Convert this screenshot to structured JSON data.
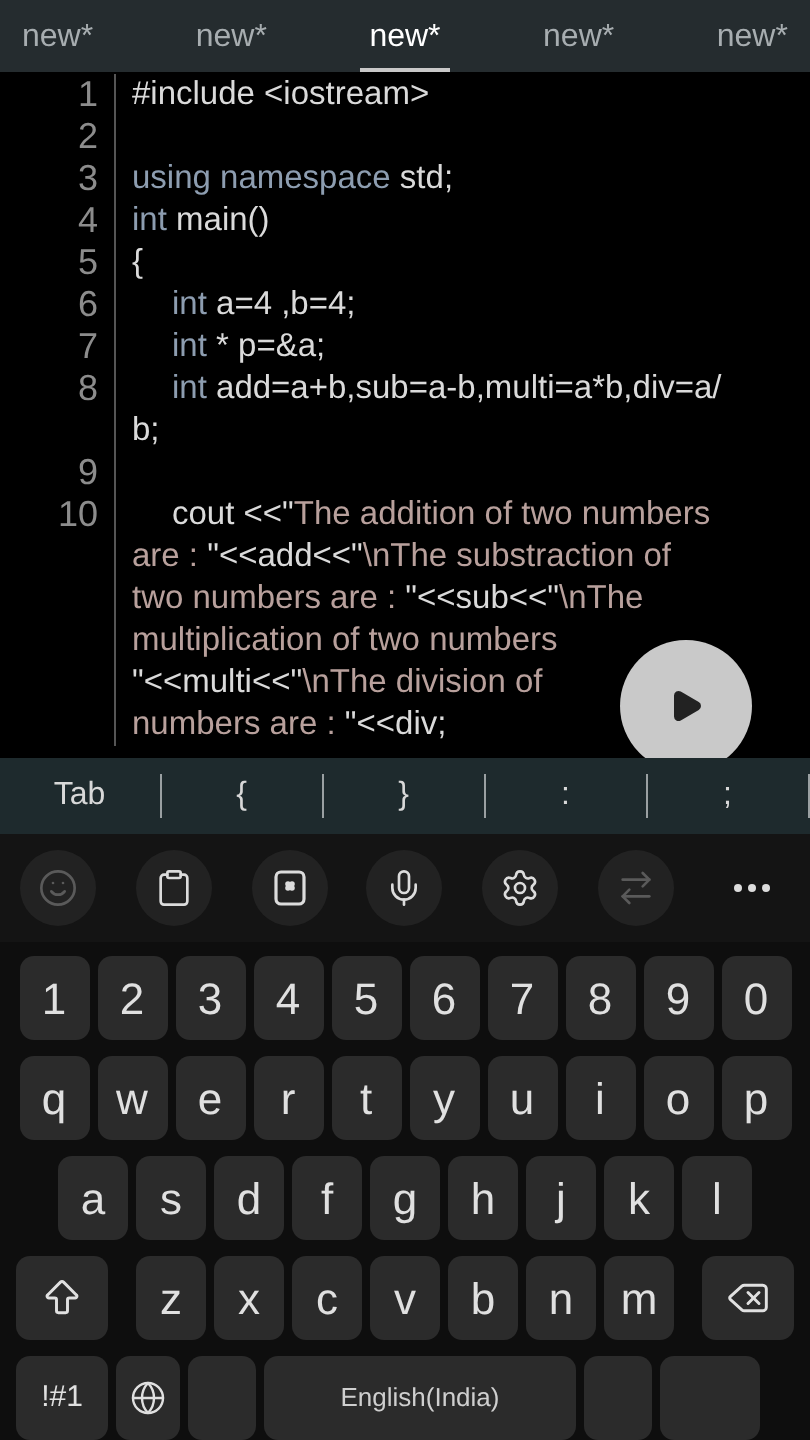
{
  "tabs": [
    {
      "label": "new*",
      "selected": false
    },
    {
      "label": "new*",
      "selected": false
    },
    {
      "label": "new*",
      "selected": true
    },
    {
      "label": "new*",
      "selected": false
    },
    {
      "label": "new*",
      "selected": false
    }
  ],
  "editor": {
    "lines": [
      {
        "number": "1",
        "indented": false,
        "rows": [
          [
            {
              "kind": "plain",
              "text": "#include <iostream>"
            }
          ]
        ]
      },
      {
        "number": "2",
        "rows": [
          []
        ]
      },
      {
        "number": "3",
        "indented": false,
        "rows": [
          [
            {
              "kind": "keyword",
              "text": "using namespace"
            },
            {
              "kind": "plain",
              "text": " std;"
            }
          ]
        ]
      },
      {
        "number": "4",
        "indented": false,
        "rows": [
          [
            {
              "kind": "keyword",
              "text": "int"
            },
            {
              "kind": "plain",
              "text": " main()"
            }
          ]
        ]
      },
      {
        "number": "5",
        "indented": false,
        "rows": [
          [
            {
              "kind": "plain",
              "text": "{"
            }
          ]
        ]
      },
      {
        "number": "6",
        "indented": true,
        "rows": [
          [
            {
              "kind": "keyword",
              "text": "int"
            },
            {
              "kind": "plain",
              "text": " a=4 ,b=4;"
            }
          ]
        ]
      },
      {
        "number": "7",
        "indented": true,
        "rows": [
          [
            {
              "kind": "keyword",
              "text": "int"
            },
            {
              "kind": "plain",
              "text": " * p=&a;"
            }
          ]
        ]
      },
      {
        "number": "8",
        "indented": true,
        "rows": [
          [
            {
              "kind": "keyword",
              "text": "int"
            },
            {
              "kind": "plain",
              "text": " add=a+b,sub=a-b,multi=a*b,div=a/"
            }
          ],
          [
            {
              "kind": "plain",
              "text": "b;"
            }
          ]
        ]
      },
      {
        "number": "9",
        "rows": [
          []
        ]
      },
      {
        "number": "10",
        "indented": true,
        "rows": [
          [
            {
              "kind": "plain",
              "text": "cout <<\""
            },
            {
              "kind": "string",
              "text": "The addition of two numbers"
            }
          ],
          [
            {
              "kind": "string",
              "text": "are : "
            },
            {
              "kind": "plain",
              "text": "\"<<add<<\""
            },
            {
              "kind": "string",
              "text": "\\nThe substraction of"
            }
          ],
          [
            {
              "kind": "string",
              "text": "two numbers are : "
            },
            {
              "kind": "plain",
              "text": "\"<<sub<<\""
            },
            {
              "kind": "string",
              "text": "\\nThe"
            }
          ],
          [
            {
              "kind": "string",
              "text": "multiplication of two numbers"
            }
          ],
          [
            {
              "kind": "plain",
              "text": "\"<<multi<<\""
            },
            {
              "kind": "string",
              "text": "\\nThe division of"
            }
          ],
          [
            {
              "kind": "string",
              "text": "numbers are : "
            },
            {
              "kind": "plain",
              "text": "\"<<div;"
            }
          ]
        ]
      }
    ]
  },
  "extra_keys": [
    "Tab",
    "{",
    "}",
    ":",
    ";"
  ],
  "toolbar": [
    {
      "kind": "emoji",
      "disabled": true
    },
    {
      "kind": "clipboard",
      "disabled": false
    },
    {
      "kind": "keypad",
      "disabled": false
    },
    {
      "kind": "mic",
      "disabled": false
    },
    {
      "kind": "settings",
      "disabled": false
    },
    {
      "kind": "swap",
      "disabled": true
    },
    {
      "kind": "more",
      "disabled": false
    }
  ],
  "keyboard": {
    "rows": [
      [
        "1",
        "2",
        "3",
        "4",
        "5",
        "6",
        "7",
        "8",
        "9",
        "0"
      ],
      [
        "q",
        "w",
        "e",
        "r",
        "t",
        "y",
        "u",
        "i",
        "o",
        "p"
      ],
      [
        "a",
        "s",
        "d",
        "f",
        "g",
        "h",
        "j",
        "k",
        "l"
      ],
      [
        "z",
        "x",
        "c",
        "v",
        "b",
        "n",
        "m"
      ]
    ],
    "symbols_key": "!#1",
    "space_label": "English(India)"
  }
}
